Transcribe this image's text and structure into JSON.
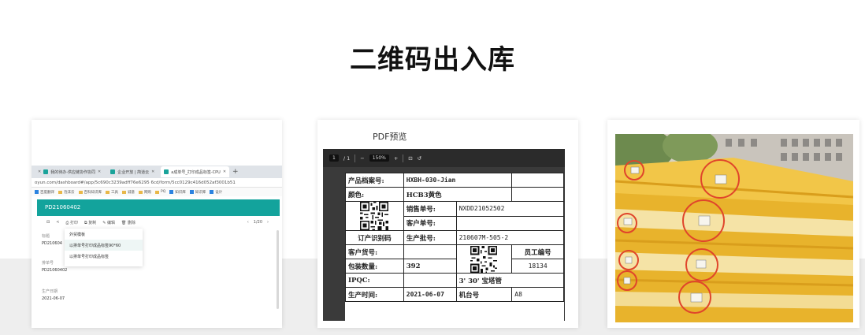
{
  "slide": {
    "title": "二维码出入库"
  },
  "browser": {
    "tabs": [
      {
        "label": "我的待办-供应链协作协同"
      },
      {
        "label": "企业开放 | 简道云"
      },
      {
        "label": "a成单号_打印成品标签-CPU"
      }
    ],
    "url": "oyun.com/dashboard#/app/5c690c3239adff76e6295 6cd/form/5cc0129c416d052af3001b51",
    "bookmarks": [
      "百度翻译",
      "泡沫云",
      "百科知识库",
      "工具",
      "诚意",
      "网购",
      "PQ",
      "知识库",
      "知识库",
      "设计"
    ],
    "header_code": "PD21060402",
    "toolbar": {
      "print": "打印",
      "copy": "复制",
      "edit": "编辑",
      "delete": "删除",
      "pager": "1/20"
    },
    "menu_items": [
      "外贸模板",
      "以排单号打印成品标签90*60",
      "以排单号打印成品标签"
    ],
    "form": {
      "label_1": "标题",
      "value_1": "PD210604",
      "label_2": "排单号",
      "value_2": "PD21060402",
      "label_3": "生产日期",
      "value_3": "2021-06-07"
    }
  },
  "pdf": {
    "heading": "PDF预览",
    "page_current": "1",
    "page_total": "/ 1",
    "zoom": "150%",
    "sheet": {
      "file_label": "产品档案号:",
      "file_value": "HXBH-030-Jian",
      "color_label": "颜色:",
      "color_value": "HCB3黄色",
      "sales_label": "销售单号:",
      "sales_value": "NXDD21052502",
      "cust_label": "客户单号:",
      "cust_value": "",
      "order_label": "订产识别码",
      "batch_label": "生产批号:",
      "batch_value": "210607M-505-2",
      "cust_item_label": "客户货号:",
      "cust_item_value": "",
      "employee_label": "员工编号",
      "employee_value": "18134",
      "pack_label": "包装数量:",
      "pack_value": "392",
      "ipqc_label": "IPQC:",
      "spec_value": "3' 30' 宝塔管",
      "date_label": "生产时间:",
      "date_value": "2021-06-07",
      "machine_label": "机台号",
      "machine_value": "A8"
    }
  },
  "colors": {
    "teal": "#13a39c",
    "viewer_bg": "#3a3a3a",
    "highlight_circle": "#e0452b"
  },
  "icons": [
    "plus-icon",
    "minus-icon",
    "fit-page-icon",
    "rotate-icon",
    "print-icon",
    "copy-icon",
    "edit-icon",
    "delete-icon",
    "close-icon"
  ]
}
